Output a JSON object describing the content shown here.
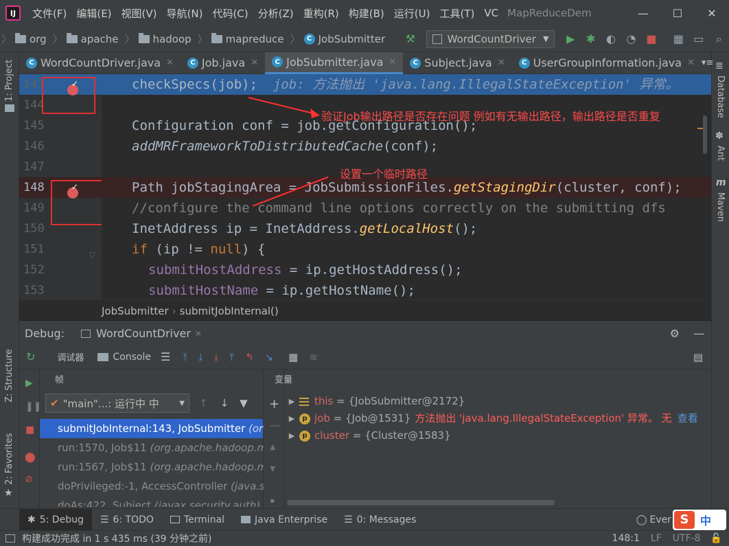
{
  "menu": {
    "items": [
      "文件(F)",
      "编辑(E)",
      "视图(V)",
      "导航(N)",
      "代码(C)",
      "分析(Z)",
      "重构(R)",
      "构建(B)",
      "运行(U)",
      "工具(T)",
      "VC"
    ],
    "project_title": "MapReduceDem"
  },
  "nav": {
    "crumbs": [
      "org",
      "apache",
      "hadoop",
      "mapreduce"
    ],
    "current_class": "JobSubmitter",
    "run_config": "WordCountDriver"
  },
  "tabs": [
    "WordCountDriver.java",
    "Job.java",
    "JobSubmitter.java",
    "Subject.java",
    "UserGroupInformation.java"
  ],
  "left_strip": {
    "project": "1: Project",
    "structure": "Z: Structure",
    "favorites": "2: Favorites"
  },
  "right_strip": {
    "database": "Database",
    "ant": "Ant",
    "maven": "Maven"
  },
  "editor": {
    "line_numbers": [
      "143",
      "144",
      "145",
      "146",
      "147",
      "148",
      "149",
      "150",
      "151",
      "152",
      "153"
    ],
    "l143_code": "checkSpecs(job);",
    "l143_hint": "job: 方法抛出 'java.lang.IllegalStateException' 异常。",
    "l145_a": "Configuration conf = job.getConfiguration();",
    "l146_a": "addMRFrameworkToDistributedCache",
    "l146_b": "(conf);",
    "l148_a": "Path jobStagingArea = JobSubmissionFiles.",
    "l148_b": "getStagingDir",
    "l148_c": "(cluster, conf);",
    "l149": "//configure the command line options correctly on the submitting dfs",
    "l150_a": "InetAddress ip = InetAddress.",
    "l150_b": "getLocalHost",
    "l150_c": "();",
    "l151_kw": "if",
    "l151_a": " (ip != ",
    "l151_null": "null",
    "l151_b": ") {",
    "l152_field": "submitHostAddress",
    "l152_b": " = ip.getHostAddress();",
    "l153_field": "submitHostName",
    "l153_b": " = ip.getHostName();",
    "annotation1": "验证Job输出路径是否存在问题 例如有无输出路径，输出路径是否重复",
    "annotation2": "设置一个临时路径",
    "breadcrumb_class": "JobSubmitter",
    "breadcrumb_method": "submitJobInternal()"
  },
  "debug": {
    "label": "Debug:",
    "session": "WordCountDriver",
    "debugger_tab": "调试器",
    "console_tab": "Console",
    "frames_header": "帧",
    "vars_header": "变量",
    "thread_selector": "\"main\"...: 运行中 中",
    "frames": [
      {
        "method": "submitJobInternal:143, JobSubmitter",
        "pkg": "(or"
      },
      {
        "method": "run:1570, Job$11",
        "pkg": "(org.apache.hadoop.m"
      },
      {
        "method": "run:1567, Job$11",
        "pkg": "(org.apache.hadoop.m"
      },
      {
        "method": "doPrivileged:-1, AccessController",
        "pkg": "(java.s"
      },
      {
        "method": "doAs:422, Subject",
        "pkg": "(javax.security.auth)"
      }
    ],
    "vars": [
      {
        "name": "this",
        "value": "{JobSubmitter@2172}"
      },
      {
        "name": "job",
        "value": "{Job@1531}",
        "error": "方法抛出 'java.lang.IllegalStateException' 异常。 无",
        "link": "查看"
      },
      {
        "name": "cluster",
        "value": "{Cluster@1583}"
      }
    ]
  },
  "tool_tabs": {
    "debug": "5: Debug",
    "todo": "6: TODO",
    "terminal": "Terminal",
    "java_ee": "Java Enterprise",
    "messages": "0: Messages",
    "event_log": "Ever",
    "ime": "中"
  },
  "status": {
    "message": "构建成功完成 in 1 s 435 ms (39 分钟之前)",
    "position": "148:1",
    "line_sep": "LF",
    "encoding": "UTF-8"
  },
  "colors": {
    "accent": "#4a88c7",
    "selected_frame": "#2f65ca",
    "breakpoint": "#db5c5c",
    "annotation": "#ff4a4a"
  }
}
